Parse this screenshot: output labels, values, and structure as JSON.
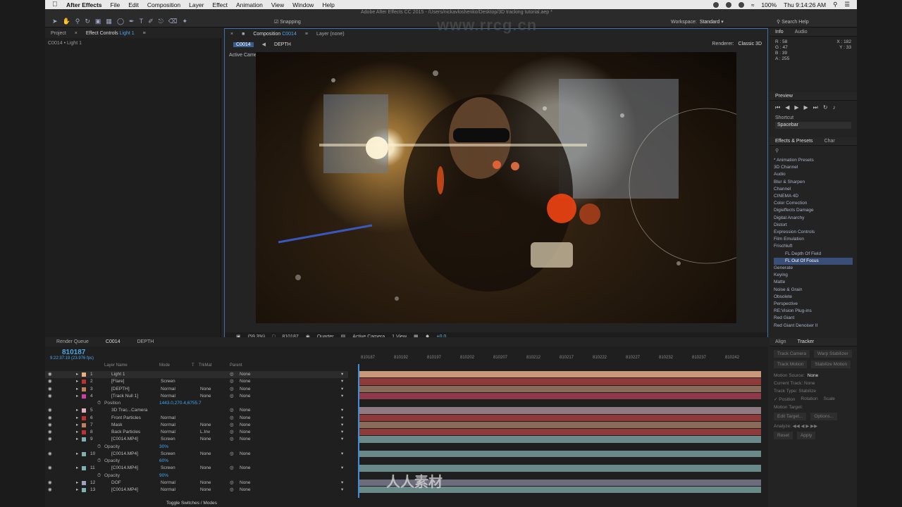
{
  "menubar": {
    "app": "After Effects",
    "items": [
      "File",
      "Edit",
      "Composition",
      "Layer",
      "Effect",
      "Animation",
      "View",
      "Window",
      "Help"
    ],
    "battery": "100%",
    "clock": "Thu 9:14:26 AM"
  },
  "window_title": "Adobe After Effects CC 2015 - /Users/nickavloshenko/Desktop/3D tracking tutorial.aep *",
  "toolbar": {
    "snapping": "Snapping",
    "workspace_label": "Workspace:",
    "workspace_value": "Standard",
    "search": "Search Help"
  },
  "left_panel": {
    "tab_project": "Project",
    "tab_effect_controls": "Effect Controls",
    "tab_effect_controls_target": "Light 1",
    "breadcrumb": "C0014 • Light 1"
  },
  "viewer": {
    "tab_composition": "Composition",
    "tab_composition_name": "C0014",
    "tab_layer": "Layer (none)",
    "subtab_1": "C0014",
    "subtab_2": "DEPTH",
    "renderer_label": "Renderer:",
    "renderer_value": "Classic 3D",
    "active_camera": "Active Camera",
    "zoom": "(59.3%)",
    "timecode": "810187",
    "resolution": "Quarter",
    "camera_select": "Active Camera",
    "views": "1 View",
    "exposure": "+0.0"
  },
  "info": {
    "tab_info": "Info",
    "tab_audio": "Audio",
    "r": "R : 58",
    "g": "G : 47",
    "b": "B : 39",
    "a": "A : 255",
    "x": "X : 182",
    "y": "Y : 33"
  },
  "preview": {
    "title": "Preview",
    "shortcut_label": "Shortcut",
    "shortcut_value": "Spacebar"
  },
  "effects": {
    "tab": "Effects & Presets",
    "tab_char": "Char",
    "items": [
      "* Animation Presets",
      "3D Channel",
      "Audio",
      "Blur & Sharpen",
      "Channel",
      "CINEMA 4D",
      "Color Correction",
      "Digieffects Damage",
      "Digital Anarchy",
      "Distort",
      "Expression Controls",
      "Film Emulation",
      "Frischluft"
    ],
    "sub_items": [
      "FL Depth Of Field",
      "FL Out Of Focus"
    ],
    "items_after": [
      "Generate",
      "Keying",
      "Matte",
      "Noise & Grain",
      "Obsolete",
      "Perspective",
      "RE:Vision Plug-ins",
      "Red Giant",
      "Red Giant Denoiser II"
    ]
  },
  "tracker": {
    "tab_align": "Align",
    "tab_tracker": "Tracker",
    "track_camera": "Track Camera",
    "warp_stabilizer": "Warp Stabilizer",
    "track_motion": "Track Motion",
    "stabilize_motion": "Stabilize Motion",
    "motion_source_label": "Motion Source:",
    "motion_source_value": "None",
    "current_track_label": "Current Track:",
    "current_track_value": "None",
    "track_type_label": "Track Type:",
    "track_type_value": "Stabilize",
    "position": "Position",
    "rotation": "Rotation",
    "scale": "Scale",
    "motion_target": "Motion Target:",
    "edit_target": "Edit Target...",
    "options": "Options...",
    "analyze": "Analyze:",
    "reset": "Reset",
    "apply": "Apply"
  },
  "timeline": {
    "tab_render": "Render Queue",
    "tab_comp": "C0014",
    "tab_depth": "DEPTH",
    "time": "810187",
    "fps": "9:22:37:19 (23.976 fps)",
    "col_layer_name": "Layer Name",
    "col_mode": "Mode",
    "col_t": "T",
    "col_trkmat": "TrkMat",
    "col_parent": "Parent",
    "ruler": [
      "810187",
      "810192",
      "810197",
      "810202",
      "810207",
      "810212",
      "810217",
      "810222",
      "810227",
      "810232",
      "810237",
      "810242"
    ],
    "toggle": "Toggle Switches / Modes",
    "rows": [
      {
        "num": "1",
        "name": "Light 1",
        "mode": "",
        "trk": "",
        "parent": "None",
        "color": "#e8b080",
        "bar": "#c89878",
        "prop": false
      },
      {
        "num": "2",
        "name": "[Flare]",
        "mode": "Screen",
        "trk": "",
        "parent": "None",
        "color": "#c03030",
        "bar": "#8e3a3a",
        "prop": false
      },
      {
        "num": "3",
        "name": "[DEPTH]",
        "mode": "Normal",
        "trk": "None",
        "parent": "None",
        "color": "#c08060",
        "bar": "#8a6a58",
        "prop": false
      },
      {
        "num": "4",
        "name": "[Track Null 1]",
        "mode": "Normal",
        "trk": "None",
        "parent": "None",
        "color": "#d040a0",
        "bar": "#8e3a4c",
        "prop": false
      },
      {
        "num": "",
        "name": "Position",
        "mode": "1443.0,270.4,6755.7",
        "trk": "",
        "parent": "",
        "color": "",
        "bar": "",
        "prop": true
      },
      {
        "num": "5",
        "name": "3D Trac...Camera",
        "mode": "",
        "trk": "",
        "parent": "None",
        "color": "#e0b0c0",
        "bar": "#8e7a80",
        "prop": false
      },
      {
        "num": "6",
        "name": "Front Particles",
        "mode": "Normal",
        "trk": "",
        "parent": "None",
        "color": "#c03030",
        "bar": "#8e3a3a",
        "prop": false
      },
      {
        "num": "7",
        "name": "Mask",
        "mode": "Normal",
        "trk": "None",
        "parent": "None",
        "color": "#c08060",
        "bar": "#8a6a58",
        "prop": false
      },
      {
        "num": "8",
        "name": "Back Particles",
        "mode": "Normal",
        "trk": "L.Inv",
        "parent": "None",
        "color": "#c03030",
        "bar": "#8e3a3a",
        "prop": false
      },
      {
        "num": "9",
        "name": "[C0014.MP4]",
        "mode": "Screen",
        "trk": "None",
        "parent": "None",
        "color": "#80b0b0",
        "bar": "#6a8a8a",
        "prop": false
      },
      {
        "num": "",
        "name": "Opacity",
        "mode": "30%",
        "trk": "",
        "parent": "",
        "color": "",
        "bar": "",
        "prop": true
      },
      {
        "num": "10",
        "name": "[C0014.MP4]",
        "mode": "Screen",
        "trk": "None",
        "parent": "None",
        "color": "#80b0b0",
        "bar": "#6a8a8a",
        "prop": false
      },
      {
        "num": "",
        "name": "Opacity",
        "mode": "60%",
        "trk": "",
        "parent": "",
        "color": "",
        "bar": "",
        "prop": true
      },
      {
        "num": "11",
        "name": "[C0014.MP4]",
        "mode": "Screen",
        "trk": "None",
        "parent": "None",
        "color": "#80b0b0",
        "bar": "#6a8a8a",
        "prop": false
      },
      {
        "num": "",
        "name": "Opacity",
        "mode": "90%",
        "trk": "",
        "parent": "",
        "color": "",
        "bar": "",
        "prop": true
      },
      {
        "num": "12",
        "name": "DOF",
        "mode": "Normal",
        "trk": "None",
        "parent": "None",
        "color": "#a0a0c0",
        "bar": "#6c6c7c",
        "prop": false
      },
      {
        "num": "13",
        "name": "[C0014.MP4]",
        "mode": "Normal",
        "trk": "None",
        "parent": "None",
        "color": "#80b0b0",
        "bar": "#6a8a8a",
        "prop": false
      }
    ]
  },
  "watermark": "www.rrcg.cn",
  "watermark_bottom": "人人素材"
}
